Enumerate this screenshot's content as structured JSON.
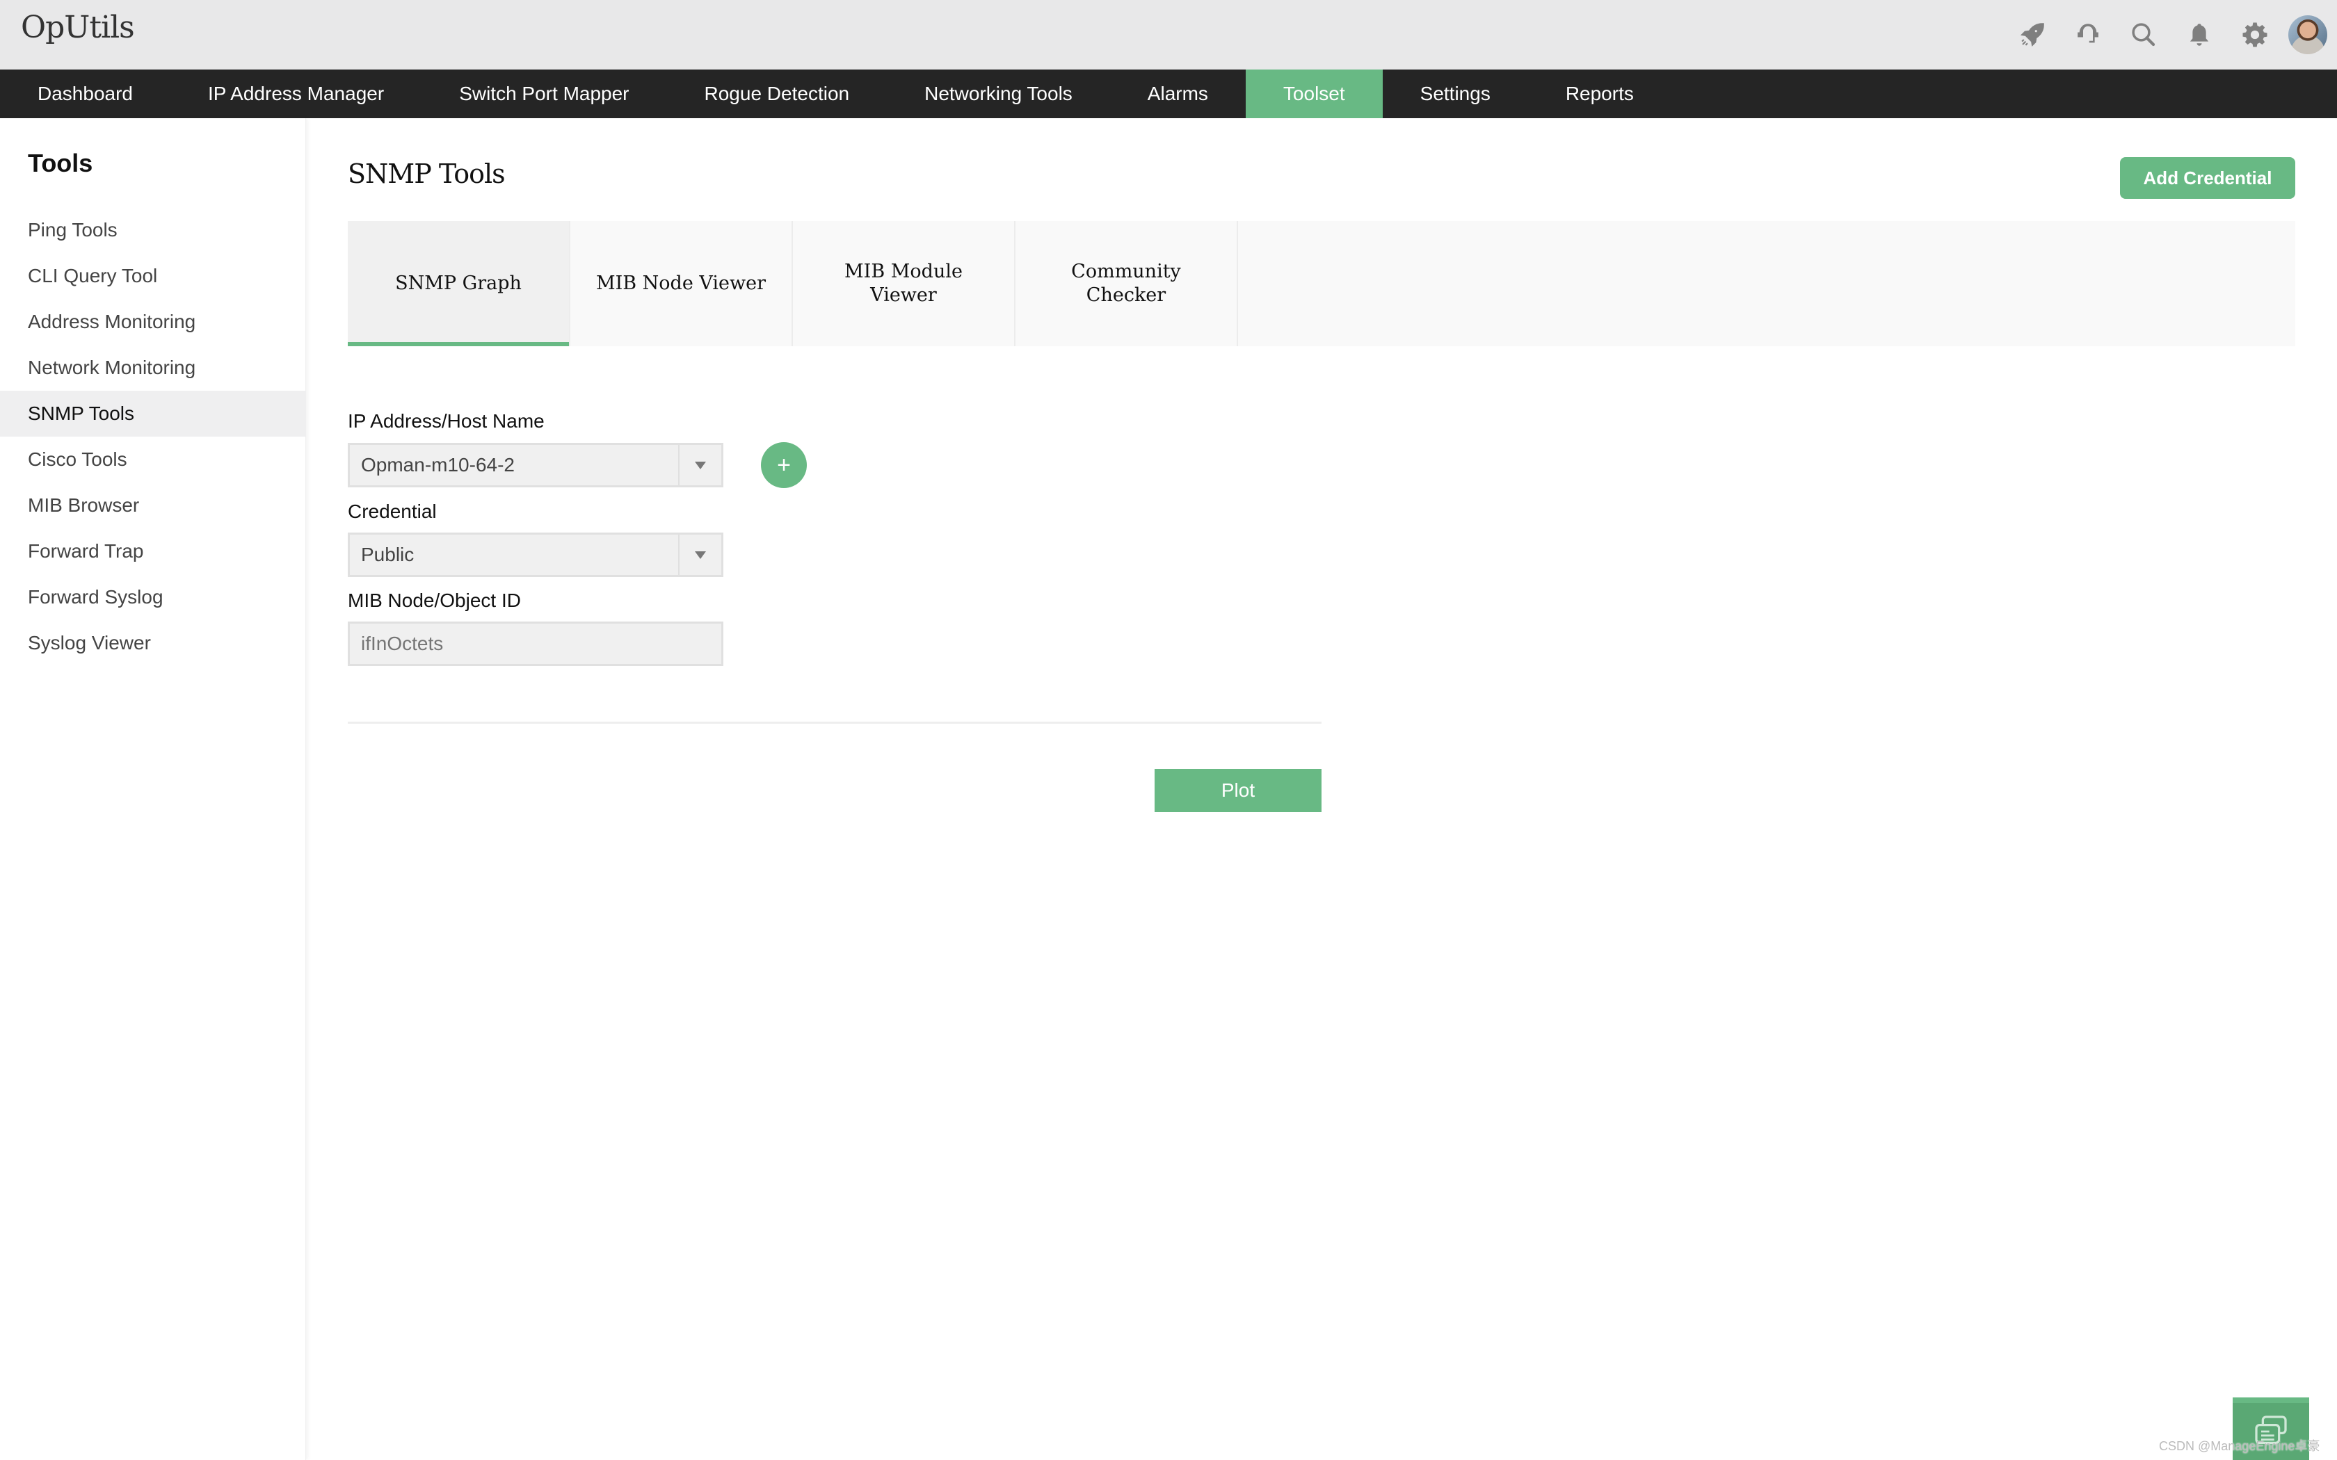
{
  "app": {
    "title": "OpUtils"
  },
  "header_icons": [
    {
      "name": "rocket-icon"
    },
    {
      "name": "headset-icon"
    },
    {
      "name": "search-icon"
    },
    {
      "name": "bell-icon"
    },
    {
      "name": "gear-icon"
    }
  ],
  "nav": {
    "items": [
      {
        "label": "Dashboard",
        "active": false
      },
      {
        "label": "IP Address Manager",
        "active": false
      },
      {
        "label": "Switch Port Mapper",
        "active": false
      },
      {
        "label": "Rogue Detection",
        "active": false
      },
      {
        "label": "Networking Tools",
        "active": false
      },
      {
        "label": "Alarms",
        "active": false
      },
      {
        "label": "Toolset",
        "active": true
      },
      {
        "label": "Settings",
        "active": false
      },
      {
        "label": "Reports",
        "active": false
      }
    ],
    "accent_color": "#68b984"
  },
  "sidebar": {
    "title": "Tools",
    "items": [
      {
        "label": "Ping Tools",
        "active": false
      },
      {
        "label": "CLI Query Tool",
        "active": false
      },
      {
        "label": "Address Monitoring",
        "active": false
      },
      {
        "label": "Network Monitoring",
        "active": false
      },
      {
        "label": "SNMP Tools",
        "active": true
      },
      {
        "label": "Cisco Tools",
        "active": false
      },
      {
        "label": "MIB Browser",
        "active": false
      },
      {
        "label": "Forward Trap",
        "active": false
      },
      {
        "label": "Forward Syslog",
        "active": false
      },
      {
        "label": "Syslog Viewer",
        "active": false
      }
    ]
  },
  "main": {
    "title": "SNMP Tools",
    "add_credential_label": "Add Credential",
    "tabs": [
      {
        "label": "SNMP Graph",
        "active": true
      },
      {
        "label": "MIB Node Viewer",
        "active": false
      },
      {
        "label": "MIB Module Viewer",
        "active": false
      },
      {
        "label": "Community Checker",
        "active": false
      }
    ],
    "form": {
      "ip_label": "IP Address/Host Name",
      "ip_value": "Opman-m10-64-2",
      "add_host_label": "+",
      "credential_label": "Credential",
      "credential_value": "Public",
      "mib_label": "MIB Node/Object ID",
      "mib_placeholder": "ifInOctets"
    },
    "plot_label": "Plot"
  },
  "watermark": "CSDN @ManageEngine卓豪"
}
